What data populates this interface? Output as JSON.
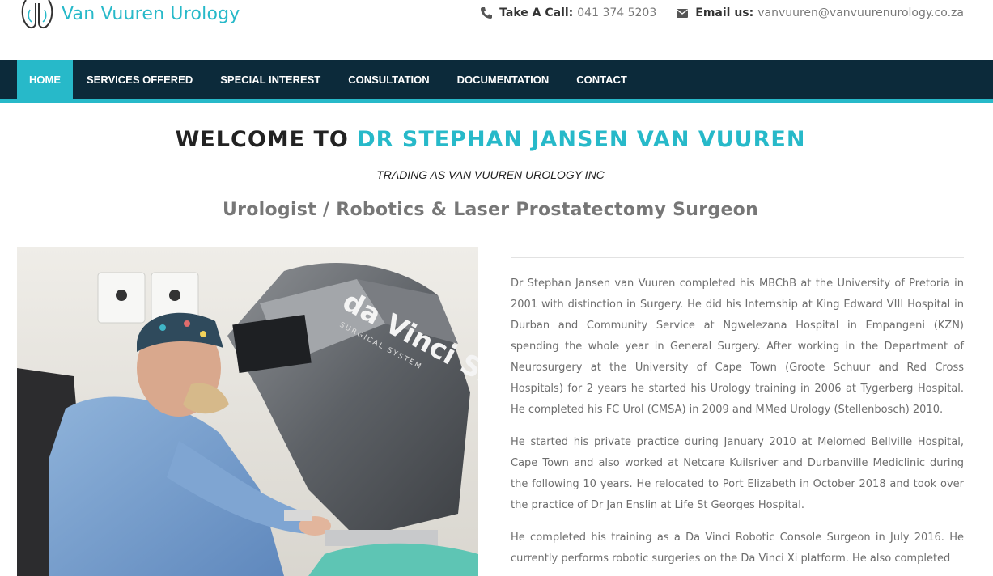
{
  "header": {
    "logo_text": "Van Vuuren Urology",
    "call_label": "Take A Call:",
    "call_value": "041 374 5203",
    "email_label": "Email us:",
    "email_value": "vanvuuren@vanvuurenurology.co.za"
  },
  "nav": {
    "items": [
      {
        "label": "HOME"
      },
      {
        "label": "SERVICES OFFERED"
      },
      {
        "label": "SPECIAL INTEREST"
      },
      {
        "label": "CONSULTATION"
      },
      {
        "label": "DOCUMENTATION"
      },
      {
        "label": "CONTACT"
      }
    ]
  },
  "hero": {
    "welcome_prefix": "WELCOME TO",
    "welcome_name": "DR STEPHAN JANSEN VAN VUUREN",
    "trading": "TRADING AS VAN VUUREN UROLOGY INC",
    "subtitle": "Urologist / Robotics & Laser Prostatectomy Surgeon"
  },
  "photo": {
    "console_brand": "da Vinci Si",
    "console_sub": "SURGICAL SYSTEM"
  },
  "bio": {
    "p1": "Dr Stephan Jansen van Vuuren completed his MBChB at the University of Pretoria in 2001 with distinction in Surgery. He did his Internship at King Edward VIII Hospital in Durban and Community Service at Ngwelezana Hospital in Empangeni (KZN) spending the whole year in General Surgery. After working in the Department of Neurosurgery at the University of Cape Town (Groote Schuur and Red Cross Hospitals) for 2 years he started his Urology training in 2006 at Tygerberg Hospital. He completed his FC Urol (CMSA) in 2009 and MMed Urology (Stellenbosch) 2010.",
    "p2": "He started his private practice during January 2010 at Melomed Bellville Hospital, Cape Town and also worked at Netcare Kuilsriver and Durbanville Mediclinic during the following 10 years. He relocated to Port Elizabeth in October 2018 and took over the practice of Dr Jan Enslin at Life St Georges Hospital.",
    "p3": "He completed his training as a Da Vinci Robotic Console Surgeon in July 2016. He currently performs robotic surgeries on the Da Vinci Xi platform. He also completed"
  },
  "colors": {
    "accent": "#27b9c9",
    "nav_bg": "#0c2a3a",
    "text": "#6d6d6d"
  },
  "icons": [
    "logo-mark-icon",
    "phone-icon",
    "envelope-icon"
  ]
}
